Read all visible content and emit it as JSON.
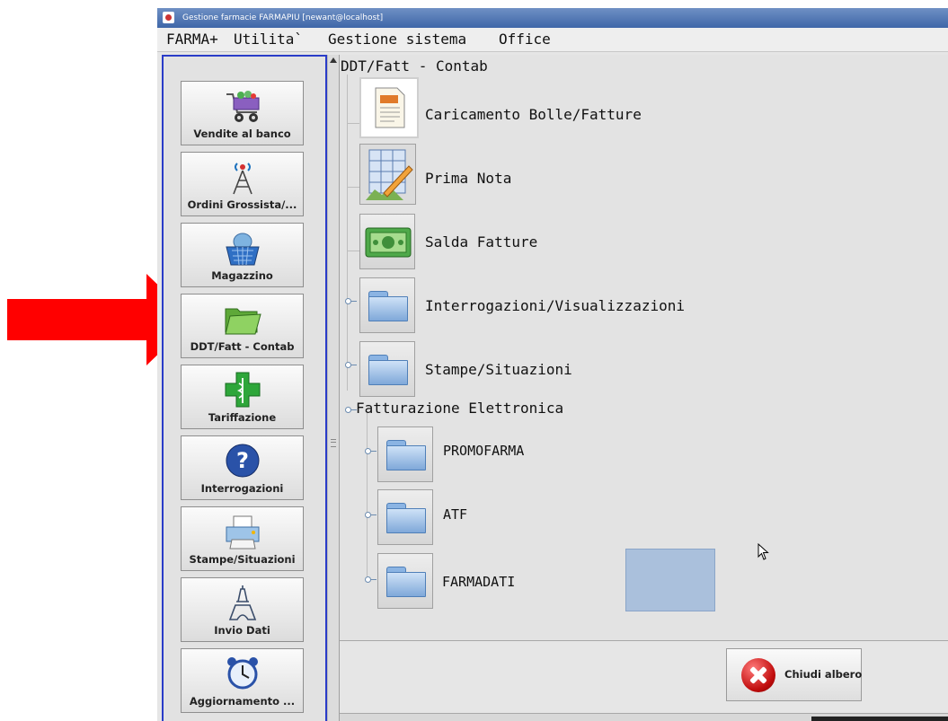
{
  "window": {
    "title": "Gestione farmacie FARMAPIU [newant@localhost]"
  },
  "menu": {
    "items": [
      "FARMA+",
      "Utilita`",
      "Gestione sistema",
      "Office"
    ]
  },
  "sidebar": {
    "buttons": [
      {
        "label": "Vendite al banco",
        "icon": "shopping-cart-icon"
      },
      {
        "label": "Ordini Grossista/...",
        "icon": "antenna-tower-icon"
      },
      {
        "label": "Magazzino",
        "icon": "warehouse-basket-icon"
      },
      {
        "label": "DDT/Fatt - Contab",
        "icon": "folder-open-icon"
      },
      {
        "label": "Tariffazione",
        "icon": "pharmacy-cross-icon"
      },
      {
        "label": "Interrogazioni",
        "icon": "help-question-icon"
      },
      {
        "label": "Stampe/Situazioni",
        "icon": "printer-icon"
      },
      {
        "label": "Invio Dati",
        "icon": "eiffel-tower-icon"
      },
      {
        "label": "Aggiornamento ...",
        "icon": "alarm-clock-icon"
      }
    ]
  },
  "tree": {
    "root": "DDT/Fatt - Contab",
    "items": [
      {
        "label": "Caricamento Bolle/Fatture",
        "icon": "document-icon"
      },
      {
        "label": "Prima Nota",
        "icon": "spreadsheet-pencil-icon"
      },
      {
        "label": "Salda Fatture",
        "icon": "money-banknote-icon"
      },
      {
        "label": "Interrogazioni/Visualizzazioni",
        "icon": "folder-icon"
      },
      {
        "label": "Stampe/Situazioni",
        "icon": "folder-icon"
      }
    ],
    "group": {
      "label": "Fatturazione Elettronica",
      "children": [
        {
          "label": "PROMOFARMA",
          "icon": "folder-icon"
        },
        {
          "label": "ATF",
          "icon": "folder-icon"
        },
        {
          "label": "FARMADATI",
          "icon": "folder-icon"
        }
      ]
    }
  },
  "footer": {
    "close_label": "Chiudi albero",
    "close_icon": "close-x-icon"
  },
  "colors": {
    "sidebar_border": "#2a3cc8",
    "arrow": "#ff0000",
    "selection": "#aac0dc"
  }
}
